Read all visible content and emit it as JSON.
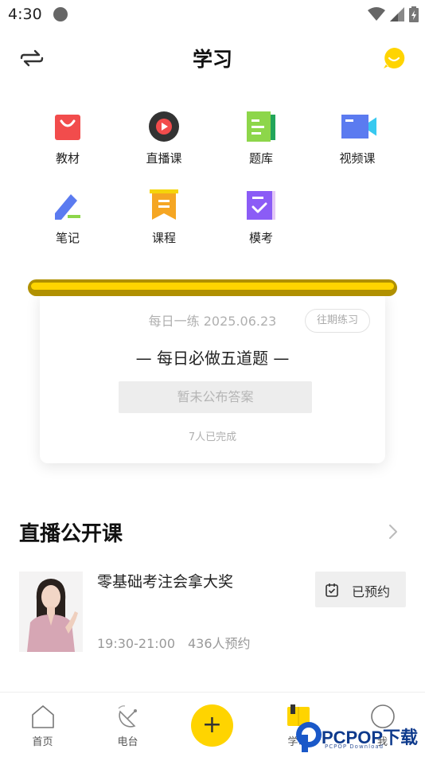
{
  "status_bar": {
    "time": "4:30",
    "icons": [
      "wifi-icon",
      "signal-icon",
      "battery-icon"
    ]
  },
  "header": {
    "title": "学习",
    "left_icon": "switch-arrows-icon",
    "right_icon": "chat-bubble-icon"
  },
  "grid": {
    "items": [
      {
        "label": "教材",
        "icon": "bag-icon",
        "color": "#f24c4c"
      },
      {
        "label": "直播课",
        "icon": "play-icon",
        "color": "#333333"
      },
      {
        "label": "题库",
        "icon": "notebook-icon",
        "color": "#8dd64a"
      },
      {
        "label": "视频课",
        "icon": "video-camera-icon",
        "color": "#5b7bf0"
      },
      {
        "label": "笔记",
        "icon": "pencil-icon",
        "color": "#5b7bf0"
      },
      {
        "label": "课程",
        "icon": "bookmark-icon",
        "color": "#f5a623"
      },
      {
        "label": "模考",
        "icon": "checkbox-book-icon",
        "color": "#8b5cf6"
      }
    ]
  },
  "daily_practice": {
    "date_text": "每日一练 2025.06.23",
    "past_button": "往期练习",
    "title": "每日必做五道题",
    "answer_status": "暂未公布答案",
    "completed": "7人已完成"
  },
  "live_section": {
    "title": "直播公开课",
    "courses": [
      {
        "title": "零基础考注会拿大奖",
        "time": "19:30-21:00",
        "reservations": "436人预约",
        "button": "已预约"
      }
    ]
  },
  "tabbar": {
    "tabs": [
      {
        "label": "首页",
        "icon": "home-icon"
      },
      {
        "label": "电台",
        "icon": "radio-dish-icon"
      },
      {
        "label": "",
        "icon": "plus-icon"
      },
      {
        "label": "学习",
        "icon": "study-book-icon"
      },
      {
        "label": "我",
        "icon": "profile-circle-icon"
      }
    ],
    "plus": "+"
  },
  "watermark": {
    "text": "PCPOP下载",
    "sub": "PCPOP Download"
  },
  "colors": {
    "accent": "#ffd400",
    "text": "#222222",
    "muted": "#b0b0b0"
  }
}
